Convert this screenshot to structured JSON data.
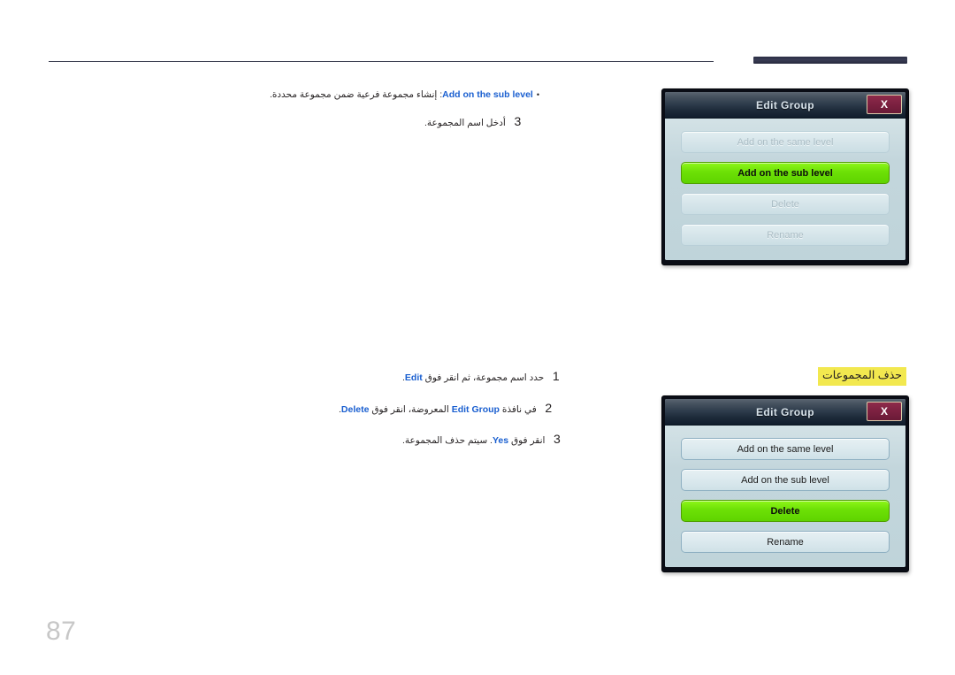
{
  "page": {
    "number": "87"
  },
  "top_section": {
    "bullet": {
      "marker": "•",
      "label": "Add on the sub level",
      "separator": ":",
      "description": "إنشاء مجموعة فرعية ضمن مجموعة محددة."
    },
    "step": {
      "number": "3",
      "text": "أدخل اسم المجموعة."
    }
  },
  "delete_section": {
    "heading": "حذف المجموعات",
    "heading_highlight_color": "#f2e84f",
    "steps": [
      {
        "number": "1",
        "prefix": "حدد اسم مجموعة، ثم انقر فوق ",
        "link": "Edit",
        "suffix": "."
      },
      {
        "number": "2",
        "prefix": "في نافذة ",
        "link": "Edit Group",
        "middle": " المعروضة، انقر فوق ",
        "link2": "Delete",
        "suffix": "."
      },
      {
        "number": "3",
        "prefix": "انقر فوق ",
        "link": "Yes",
        "suffix": ". سيتم حذف المجموعة."
      }
    ]
  },
  "dialog_top": {
    "title": "Edit Group",
    "close_label": "X",
    "buttons": [
      {
        "label": "Add on the same level",
        "state": "disabled"
      },
      {
        "label": "Add on the sub level",
        "state": "selected"
      },
      {
        "label": "Delete",
        "state": "disabled"
      },
      {
        "label": "Rename",
        "state": "disabled"
      }
    ]
  },
  "dialog_bottom": {
    "title": "Edit Group",
    "close_label": "X",
    "buttons": [
      {
        "label": "Add on the same level",
        "state": "normal"
      },
      {
        "label": "Add on the sub level",
        "state": "normal"
      },
      {
        "label": "Delete",
        "state": "selected"
      },
      {
        "label": "Rename",
        "state": "normal"
      }
    ]
  },
  "colors": {
    "link_blue": "#1a5fd0",
    "highlight_yellow": "#f2e84f",
    "selected_green": "#6ce006",
    "title_bar_navy": "#1d2a39",
    "close_maroon": "#7a2040",
    "page_number_gray": "#c7c7c7"
  }
}
